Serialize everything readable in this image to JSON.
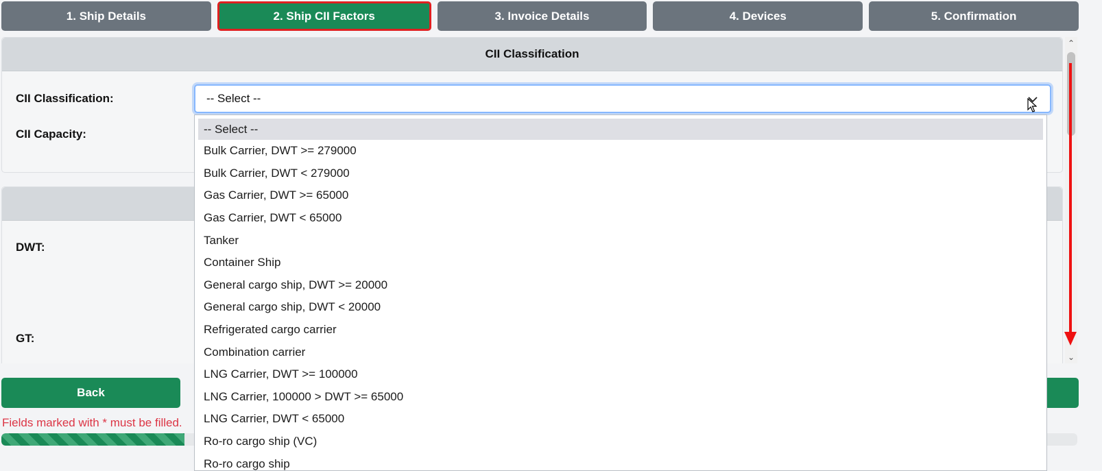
{
  "steps": [
    {
      "label": "1. Ship Details",
      "active": false
    },
    {
      "label": "2. Ship CII Factors",
      "active": true
    },
    {
      "label": "3. Invoice Details",
      "active": false
    },
    {
      "label": "4. Devices",
      "active": false
    },
    {
      "label": "5. Confirmation",
      "active": false
    }
  ],
  "cii_section": {
    "title": "CII Classification",
    "classification_label": "CII Classification:",
    "capacity_label": "CII Capacity:",
    "select_value": "-- Select --"
  },
  "second_section": {
    "dwt_label": "DWT:",
    "gt_label": "GT:"
  },
  "dropdown_options": [
    "-- Select --",
    "Bulk Carrier, DWT >= 279000",
    "Bulk Carrier, DWT < 279000",
    "Gas Carrier, DWT >= 65000",
    "Gas Carrier, DWT < 65000",
    "Tanker",
    "Container Ship",
    "General cargo ship, DWT >= 20000",
    "General cargo ship, DWT < 20000",
    "Refrigerated cargo carrier",
    "Combination carrier",
    "LNG Carrier, DWT >= 100000",
    "LNG Carrier, 100000 > DWT >= 65000",
    "LNG Carrier, DWT < 65000",
    "Ro-ro cargo ship (VC)",
    "Ro-ro cargo ship"
  ],
  "buttons": {
    "back": "Back"
  },
  "error_text": "Fields marked with * must be filled.",
  "progress_percent": 17,
  "icons": {
    "chevron": "chevron-down-icon",
    "cursor": "mouse-pointer-icon",
    "arrow": "red-arrow-annotation"
  },
  "colors": {
    "primary": "#1a8a57",
    "step_gray": "#6b747d",
    "error": "#dc3545",
    "highlight_border": "#e02020"
  }
}
